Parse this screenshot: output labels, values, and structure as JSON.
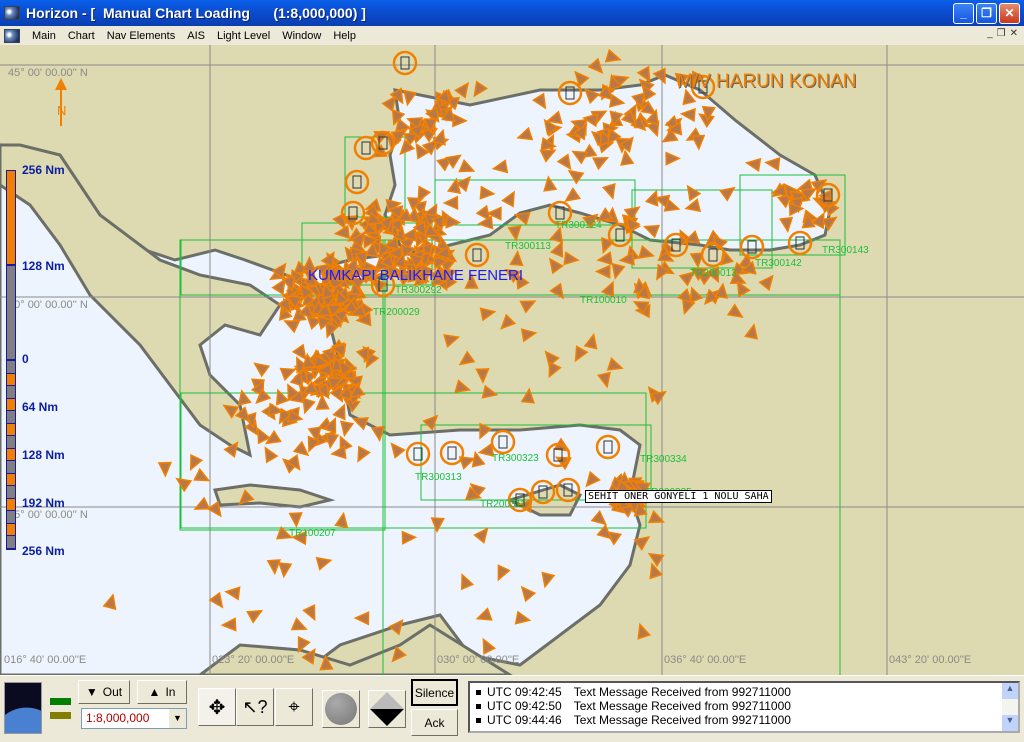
{
  "window": {
    "title": "Horizon - [  Manual Chart Loading      (1:8,000,000) ]"
  },
  "menu": [
    "Main",
    "Chart",
    "Nav Elements",
    "AIS",
    "Light Level",
    "Window",
    "Help"
  ],
  "map": {
    "colors": {
      "land": "#ddd9b1",
      "sea": "#eef4fd",
      "shallow": "#9fd8f2",
      "coast": "#6b6f68",
      "grid": "#8a8a8a",
      "chart_bounds": "#1bbf3a",
      "vessel": "#f28000"
    },
    "north_label": "N",
    "grid_labels": [
      {
        "id": "lat45",
        "text": "45° 00' 00.00'' N"
      },
      {
        "id": "lat40",
        "text": "40° 00' 00.00'' N"
      },
      {
        "id": "lat35",
        "text": "35° 00' 00.00'' N"
      },
      {
        "id": "lon16",
        "text": "016° 40' 00.00''E"
      },
      {
        "id": "lon23",
        "text": "023° 20' 00.00''E"
      },
      {
        "id": "lon30",
        "text": "030° 00' 00.00''E"
      },
      {
        "id": "lon36",
        "text": "036° 40' 00.00''E"
      },
      {
        "id": "lon43",
        "text": "043° 20' 00.00''E"
      }
    ],
    "chart_labels": [
      "TR300113",
      "TR100010",
      "TR200029",
      "TR300292",
      "TR200013",
      "TR300143",
      "TR300124",
      "TR300142",
      "TR100207",
      "TR300334",
      "TR300335",
      "TR200311",
      "TR300313",
      "TR300323"
    ],
    "vessel_name": "M/V HARUN KONAN",
    "light_name": "KUMKAPI BALIKHANE FENERI",
    "platform_name": "SEHIT ONER GONYELI 1 NOLU SAHA",
    "scale_bar": [
      "256 Nm",
      "128 Nm",
      "0",
      "64 Nm",
      "128 Nm",
      "192 Nm",
      "256 Nm"
    ]
  },
  "toolbar": {
    "zoom_out": "Out",
    "zoom_in": "In",
    "scale_value": "1:8,000,000",
    "silence": "Silence",
    "ack": "Ack"
  },
  "messages": [
    {
      "time": "UTC 09:42:45",
      "text": "Text Message Received from 992711000"
    },
    {
      "time": "UTC 09:42:50",
      "text": "Text Message Received from 992711000"
    },
    {
      "time": "UTC 09:44:46",
      "text": "Text Message Received from 992711000"
    }
  ]
}
